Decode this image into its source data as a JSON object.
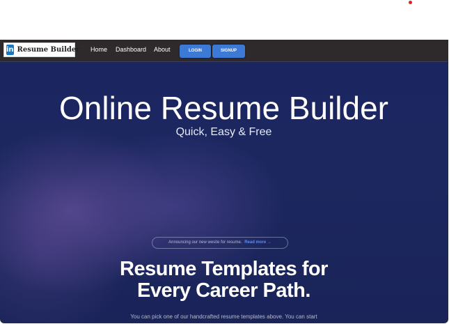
{
  "navbar": {
    "logo_badge": "in",
    "logo_text": "Resume Builder",
    "links": [
      "Home",
      "Dashboard",
      "About"
    ],
    "login_label": "LOGIN",
    "signup_label": "SIGNUP"
  },
  "hero": {
    "title": "Online Resume Builder",
    "subtitle": "Quick, Easy & Free"
  },
  "announcement": {
    "text": "Announcing our new wesite for resume.",
    "link": "Read more →"
  },
  "templates": {
    "title_line1": "Resume Templates for",
    "title_line2": "Every Career Path.",
    "description": "You can pick one of our handcrafted resume templates above. You can start"
  },
  "colors": {
    "navbar_bg": "#2e2a2c",
    "accent_button": "#3d7ad6",
    "hero_bg": "#1b2660",
    "link_accent": "#5d8df0",
    "recording_dot": "#e02020"
  }
}
